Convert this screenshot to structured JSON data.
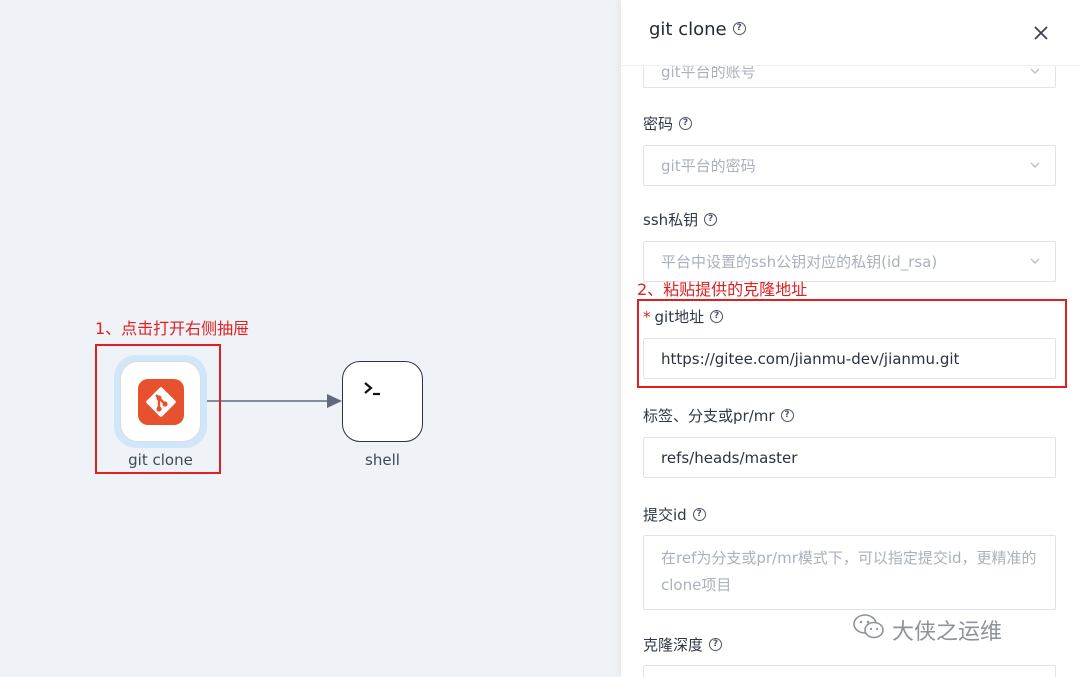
{
  "canvas": {
    "annotation_step1": "1、点击打开右侧抽屉",
    "annotation_step2": "2、粘贴提供的克隆地址",
    "nodes": {
      "git_clone": {
        "label": "git clone",
        "icon": "git-logo-icon"
      },
      "shell": {
        "label": "shell",
        "icon": "terminal-prompt-icon"
      }
    }
  },
  "drawer": {
    "title": "git clone",
    "close_icon": "close-icon",
    "fields": {
      "account": {
        "placeholder": "git平台的账号"
      },
      "password": {
        "label": "密码",
        "placeholder": "git平台的密码"
      },
      "ssh_key": {
        "label": "ssh私钥",
        "placeholder": "平台中设置的ssh公钥对应的私钥(id_rsa)"
      },
      "git_url": {
        "label": "git地址",
        "required_mark": "*",
        "value": "https://gitee.com/jianmu-dev/jianmu.git"
      },
      "ref": {
        "label": "标签、分支或pr/mr",
        "value": "refs/heads/master"
      },
      "commit_id": {
        "label": "提交id",
        "placeholder": "在ref为分支或pr/mr模式下，可以指定提交id，更精准的clone项目"
      },
      "depth": {
        "label": "克隆深度"
      }
    },
    "help_glyph": "?"
  },
  "watermark": {
    "text": "大侠之运维"
  },
  "colors": {
    "annotation_red": "#e02020",
    "git_orange": "#e8512e",
    "canvas_bg": "#eff2f6",
    "selected_halo": "#cfe6fb"
  }
}
